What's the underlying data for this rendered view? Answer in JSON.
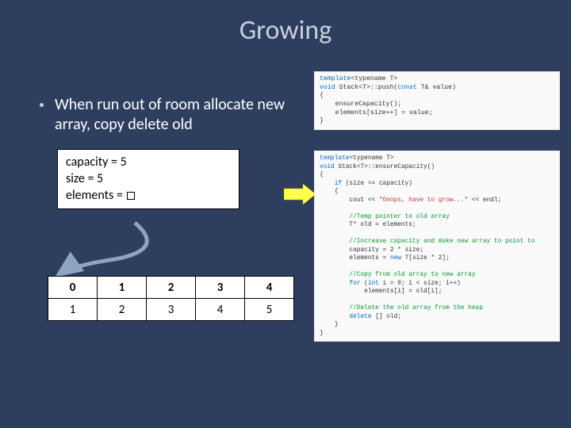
{
  "title": "Growing",
  "bullet": "When run out of room allocate new array, copy delete old",
  "state": {
    "capacity_label": "capacity = 5",
    "size_label": "size = 5",
    "elements_label": "elements = "
  },
  "table": {
    "indices": [
      "0",
      "1",
      "2",
      "3",
      "4"
    ],
    "values": [
      "1",
      "2",
      "3",
      "4",
      "5"
    ]
  },
  "code_push": {
    "l1a": "template",
    "l1b": "<typename T>",
    "l2a": "void",
    "l2b": " Stack<T>::push(",
    "l2c": "const",
    "l2d": " T& value)",
    "l3": "{",
    "l4": "    ensureCapacity();",
    "l5": "    elements[size++] = value;",
    "l6": "}"
  },
  "code_ensure": {
    "l1a": "template",
    "l1b": "<typename T>",
    "l2a": "void",
    "l2b": " Stack<T>::ensureCapacity()",
    "l3": "{",
    "l4a": "    if",
    "l4b": " (size >= capacity)",
    "l5": "    {",
    "l6a": "        cout << ",
    "l6b": "\"Ooops, have to grow...\"",
    "l6c": " << endl;",
    "l7": "",
    "l8": "        //Temp pointer to old array",
    "l9": "        T* old = elements;",
    "l10": "",
    "l11": "        //Increase capacity and make new array to point to",
    "l12": "        capacity = 2 * size;",
    "l13a": "        elements = ",
    "l13b": "new",
    "l13c": " T[size * 2];",
    "l14": "",
    "l15": "        //Copy from old array to new array",
    "l16a": "        for",
    "l16b": " (",
    "l16c": "int",
    "l16d": " i = 0; i < size; i++)",
    "l17": "            elements[i] = old[i];",
    "l18": "",
    "l19": "        //Delete the old array from the heap",
    "l20a": "        delete",
    "l20b": " [] old;",
    "l21": "    }",
    "l22": "}"
  }
}
